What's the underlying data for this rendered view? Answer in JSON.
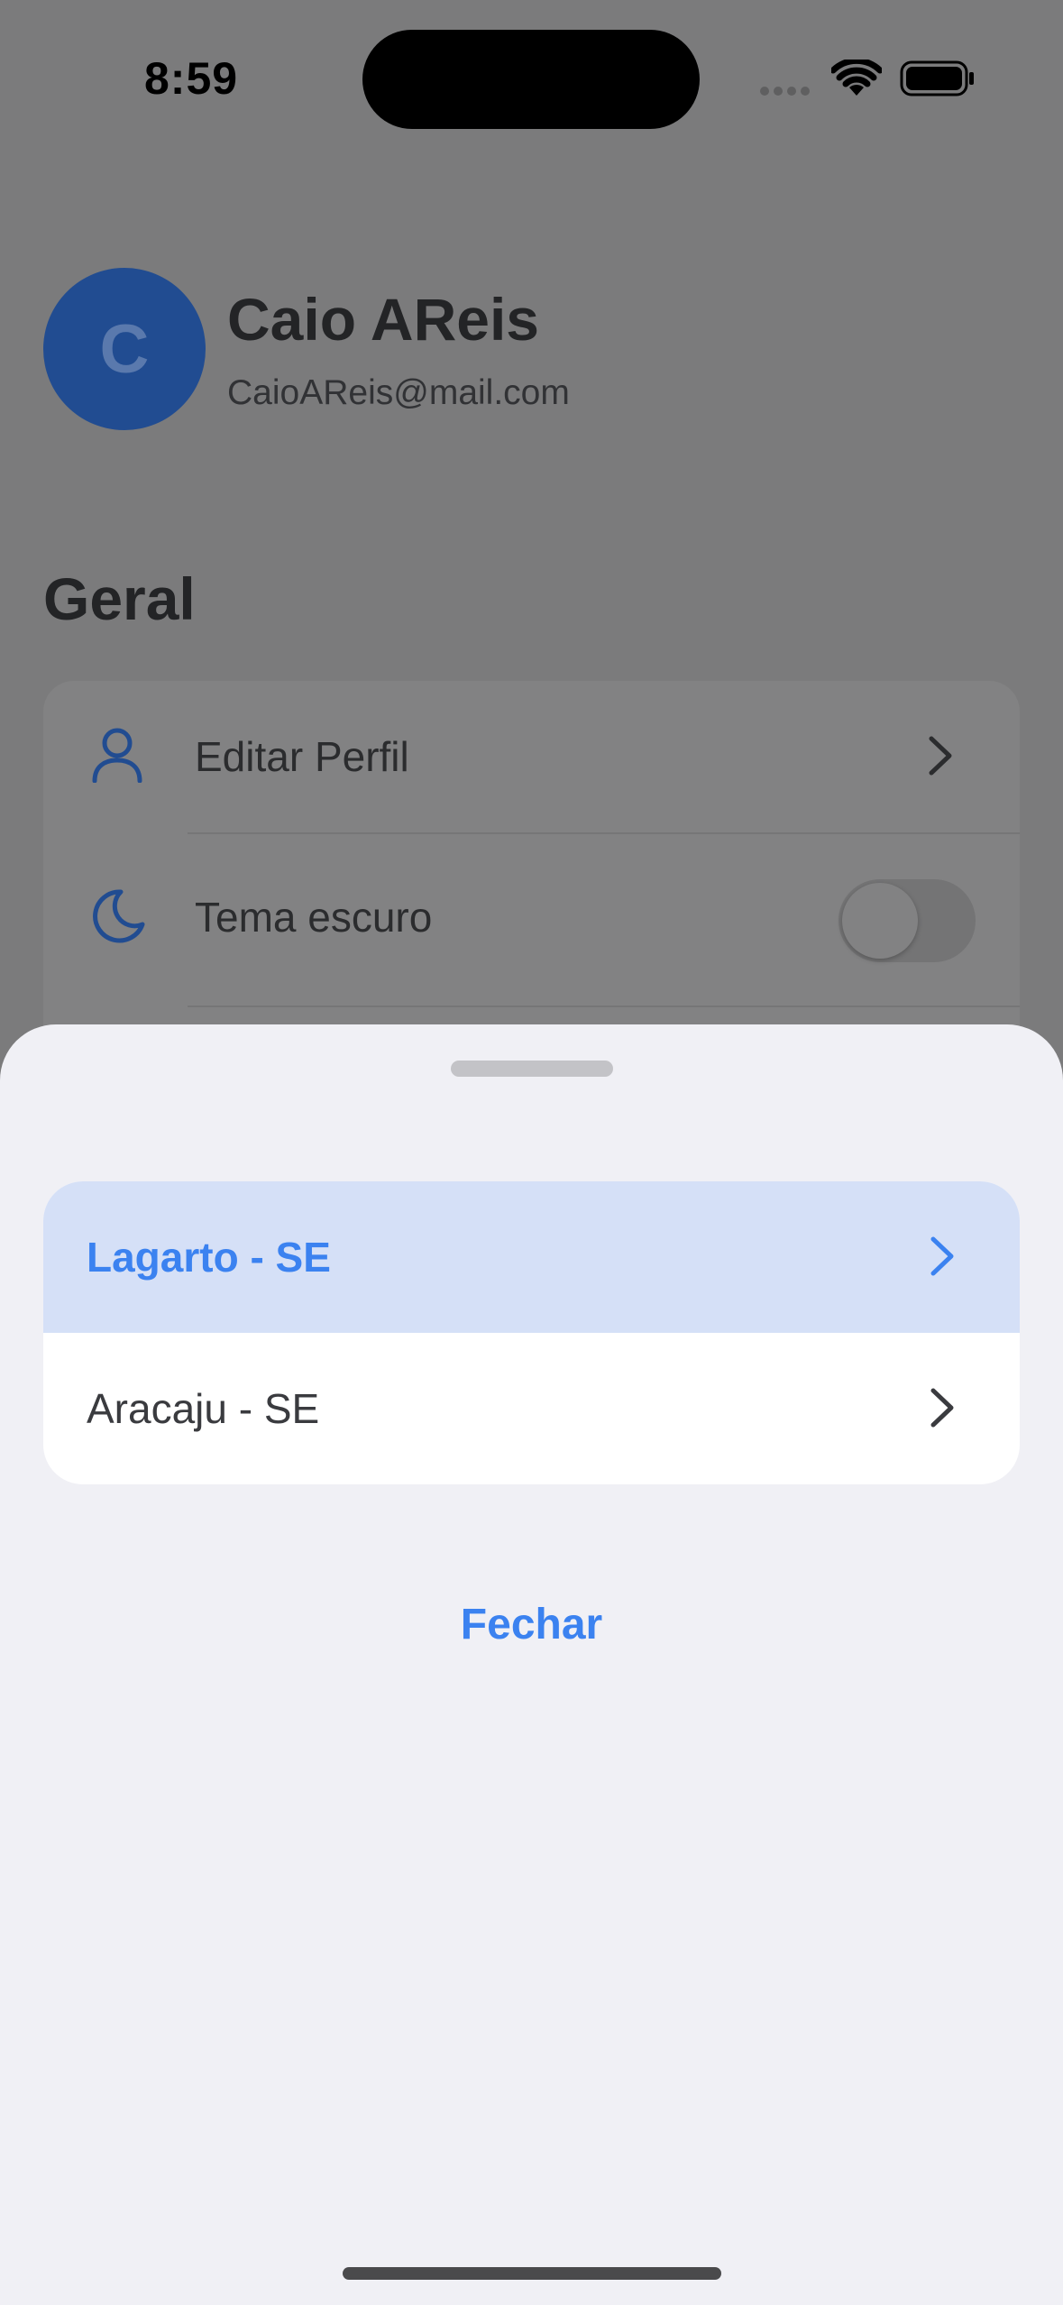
{
  "status_bar": {
    "time": "8:59",
    "icons": [
      "signal-dots-icon",
      "wifi-icon",
      "battery-icon"
    ]
  },
  "profile": {
    "avatar_letter": "C",
    "name": "Caio AReis",
    "email": "CaioAReis@mail.com"
  },
  "settings": {
    "section_title": "Geral",
    "items": [
      {
        "label": "Editar Perfil",
        "icon": "person-icon",
        "control": "chevron"
      },
      {
        "label": "Tema escuro",
        "icon": "moon-icon",
        "control": "toggle",
        "toggle_on": false
      }
    ]
  },
  "sheet": {
    "options": [
      {
        "label": "Lagarto - SE",
        "selected": true
      },
      {
        "label": "Aracaju - SE",
        "selected": false
      }
    ],
    "close_label": "Fechar"
  },
  "colors": {
    "accent": "#3b82f0",
    "selected_row_bg": "#d5e0f7",
    "avatar_bg": "#214c91",
    "sheet_bg": "#f0f0f5",
    "dimmed_bg": "#7b7b7c"
  }
}
